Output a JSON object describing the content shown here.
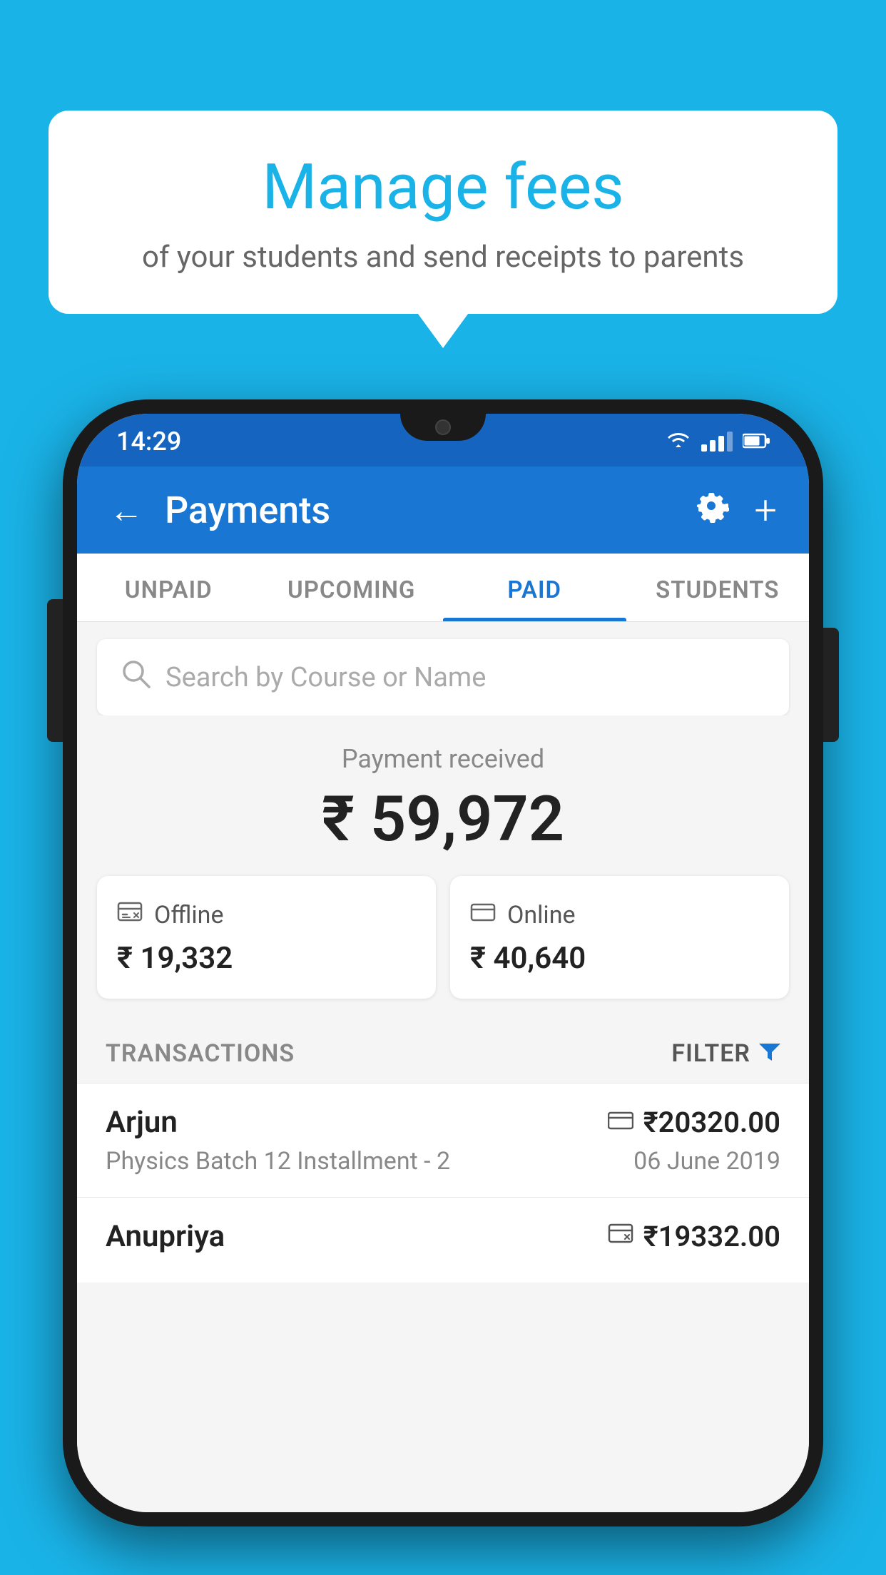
{
  "background_color": "#1ab3e8",
  "speech_bubble": {
    "title": "Manage fees",
    "subtitle": "of your students and send receipts to parents"
  },
  "status_bar": {
    "time": "14:29"
  },
  "app_bar": {
    "title": "Payments",
    "back_label": "←",
    "gear_label": "⚙",
    "plus_label": "+"
  },
  "tabs": [
    {
      "label": "UNPAID",
      "active": false
    },
    {
      "label": "UPCOMING",
      "active": false
    },
    {
      "label": "PAID",
      "active": true
    },
    {
      "label": "STUDENTS",
      "active": false
    }
  ],
  "search": {
    "placeholder": "Search by Course or Name"
  },
  "payment_received": {
    "label": "Payment received",
    "amount": "₹ 59,972"
  },
  "payment_cards": [
    {
      "icon": "offline",
      "label": "Offline",
      "amount": "₹ 19,332"
    },
    {
      "icon": "online",
      "label": "Online",
      "amount": "₹ 40,640"
    }
  ],
  "transactions_section": {
    "label": "TRANSACTIONS",
    "filter_label": "FILTER"
  },
  "transactions": [
    {
      "name": "Arjun",
      "detail": "Physics Batch 12 Installment - 2",
      "amount": "₹20320.00",
      "date": "06 June 2019",
      "icon_type": "card"
    },
    {
      "name": "Anupriya",
      "detail": "",
      "amount": "₹19332.00",
      "date": "",
      "icon_type": "offline"
    }
  ]
}
